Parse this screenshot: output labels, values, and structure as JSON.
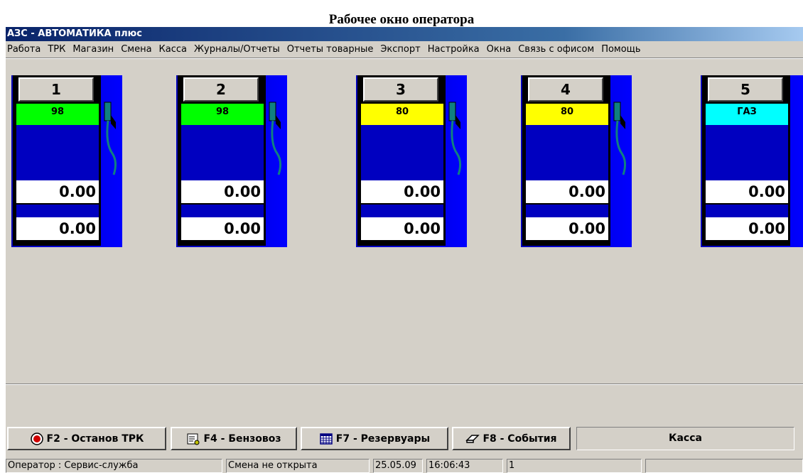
{
  "page_caption": "Рабочее окно оператора",
  "window": {
    "title": "АЗС - АВТОМАТИКА плюс"
  },
  "menu": [
    "Работа",
    "ТРК",
    "Магазин",
    "Смена",
    "Касса",
    "Журналы/Отчеты",
    "Отчеты товарные",
    "Экспорт",
    "Настройка",
    "Окна",
    "Связь с офисом",
    "Помощь"
  ],
  "pumps": [
    {
      "number": "1",
      "grade": "98",
      "grade_color": "#00ff00",
      "amount": "0.00",
      "volume": "0.00"
    },
    {
      "number": "2",
      "grade": "98",
      "grade_color": "#00ff00",
      "amount": "0.00",
      "volume": "0.00"
    },
    {
      "number": "3",
      "grade": "80",
      "grade_color": "#ffff00",
      "amount": "0.00",
      "volume": "0.00"
    },
    {
      "number": "4",
      "grade": "80",
      "grade_color": "#ffff00",
      "amount": "0.00",
      "volume": "0.00"
    },
    {
      "number": "5",
      "grade": "ГАЗ",
      "grade_color": "#00ffff",
      "amount": "0.00",
      "volume": "0.00"
    }
  ],
  "function_buttons": [
    {
      "label": "F2 - Останов ТРК",
      "icon": "stop-icon"
    },
    {
      "label": "F4 - Бензовоз",
      "icon": "fuel-truck-icon"
    },
    {
      "label": "F7 - Резервуары",
      "icon": "tank-grid-icon"
    },
    {
      "label": "F8 - События",
      "icon": "events-icon"
    }
  ],
  "kassa_label": "Касса",
  "status_bar": {
    "operator": "Оператор : Сервис-служба",
    "shift": "Смена не открыта",
    "date": "25.05.09",
    "time": "16:06:43",
    "counter": "1",
    "extra": ""
  },
  "colors": {
    "pump_blue": "#0000c0",
    "titlebar": "#0a246a",
    "window_bg": "#d4d0c8"
  }
}
